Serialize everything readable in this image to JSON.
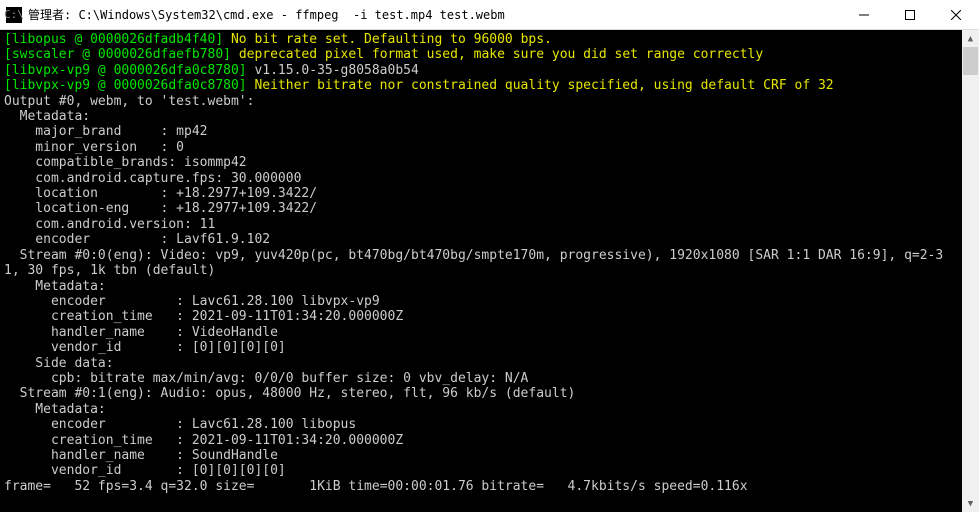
{
  "window": {
    "title": "管理者: C:\\Windows\\System32\\cmd.exe - ffmpeg  -i test.mp4 test.webm"
  },
  "colors": {
    "tag": "#00e600",
    "warn": "#e6e600",
    "plain": "#cccccc",
    "bg": "#000000"
  },
  "lines": [
    [
      [
        "tag",
        "[libopus @ 0000026dfadb4f40] "
      ],
      [
        "warn",
        "No bit rate set. Defaulting to 96000 bps."
      ]
    ],
    [
      [
        "tag",
        "[swscaler @ 0000026dfaefb780] "
      ],
      [
        "warn",
        "deprecated pixel format used, make sure you did set range correctly"
      ]
    ],
    [
      [
        "tag",
        "[libvpx-vp9 @ 0000026dfa0c8780] "
      ],
      [
        "plain",
        "v1.15.0-35-g8058a0b54"
      ]
    ],
    [
      [
        "tag",
        "[libvpx-vp9 @ 0000026dfa0c8780] "
      ],
      [
        "warn",
        "Neither bitrate nor constrained quality specified, using default CRF of 32"
      ]
    ],
    [
      [
        "plain",
        "Output #0, webm, to 'test.webm':"
      ]
    ],
    [
      [
        "plain",
        "  Metadata:"
      ]
    ],
    [
      [
        "plain",
        "    major_brand     : mp42"
      ]
    ],
    [
      [
        "plain",
        "    minor_version   : 0"
      ]
    ],
    [
      [
        "plain",
        "    compatible_brands: isommp42"
      ]
    ],
    [
      [
        "plain",
        "    com.android.capture.fps: 30.000000"
      ]
    ],
    [
      [
        "plain",
        "    location        : +18.2977+109.3422/"
      ]
    ],
    [
      [
        "plain",
        "    location-eng    : +18.2977+109.3422/"
      ]
    ],
    [
      [
        "plain",
        "    com.android.version: 11"
      ]
    ],
    [
      [
        "plain",
        "    encoder         : Lavf61.9.102"
      ]
    ],
    [
      [
        "plain",
        "  Stream #0:0(eng): Video: vp9, yuv420p(pc, bt470bg/bt470bg/smpte170m, progressive), 1920x1080 [SAR 1:1 DAR 16:9], q=2-3"
      ]
    ],
    [
      [
        "plain",
        "1, 30 fps, 1k tbn (default)"
      ]
    ],
    [
      [
        "plain",
        "    Metadata:"
      ]
    ],
    [
      [
        "plain",
        "      encoder         : Lavc61.28.100 libvpx-vp9"
      ]
    ],
    [
      [
        "plain",
        "      creation_time   : 2021-09-11T01:34:20.000000Z"
      ]
    ],
    [
      [
        "plain",
        "      handler_name    : VideoHandle"
      ]
    ],
    [
      [
        "plain",
        "      vendor_id       : [0][0][0][0]"
      ]
    ],
    [
      [
        "plain",
        "    Side data:"
      ]
    ],
    [
      [
        "plain",
        "      cpb: bitrate max/min/avg: 0/0/0 buffer size: 0 vbv_delay: N/A"
      ]
    ],
    [
      [
        "plain",
        "  Stream #0:1(eng): Audio: opus, 48000 Hz, stereo, flt, 96 kb/s (default)"
      ]
    ],
    [
      [
        "plain",
        "    Metadata:"
      ]
    ],
    [
      [
        "plain",
        "      encoder         : Lavc61.28.100 libopus"
      ]
    ],
    [
      [
        "plain",
        "      creation_time   : 2021-09-11T01:34:20.000000Z"
      ]
    ],
    [
      [
        "plain",
        "      handler_name    : SoundHandle"
      ]
    ],
    [
      [
        "plain",
        "      vendor_id       : [0][0][0][0]"
      ]
    ],
    [
      [
        "plain",
        "frame=   52 fps=3.4 q=32.0 size=       1KiB time=00:00:01.76 bitrate=   4.7kbits/s speed=0.116x    "
      ]
    ]
  ],
  "metadata_summary": {
    "output_format": "webm",
    "output_file": "test.webm",
    "major_brand": "mp42",
    "minor_version": 0,
    "compatible_brands": "isommp42",
    "capture_fps": 30.0,
    "location": "+18.2977+109.3422/",
    "android_version": 11,
    "muxer_encoder": "Lavf61.9.102",
    "video": {
      "stream": "#0:0(eng)",
      "codec": "vp9",
      "pix_fmt": "yuv420p(pc, bt470bg/bt470bg/smpte170m, progressive)",
      "resolution": "1920x1080",
      "sar": "1:1",
      "dar": "16:9",
      "q": "2-31",
      "fps": 30,
      "tbn": "1k",
      "encoder": "Lavc61.28.100 libvpx-vp9",
      "creation_time": "2021-09-11T01:34:20.000000Z",
      "handler_name": "VideoHandle",
      "vendor_id": "[0][0][0][0]",
      "cpb": "bitrate max/min/avg: 0/0/0 buffer size: 0 vbv_delay: N/A"
    },
    "audio": {
      "stream": "#0:1(eng)",
      "codec": "opus",
      "sample_rate_hz": 48000,
      "channels": "stereo",
      "sample_fmt": "flt",
      "bitrate_kbps": 96,
      "encoder": "Lavc61.28.100 libopus",
      "creation_time": "2021-09-11T01:34:20.000000Z",
      "handler_name": "SoundHandle",
      "vendor_id": "[0][0][0][0]"
    },
    "progress": {
      "frame": 52,
      "fps": 3.4,
      "q": 32.0,
      "size": "1KiB",
      "time": "00:00:01.76",
      "bitrate": "4.7kbits/s",
      "speed": "0.116x"
    }
  }
}
